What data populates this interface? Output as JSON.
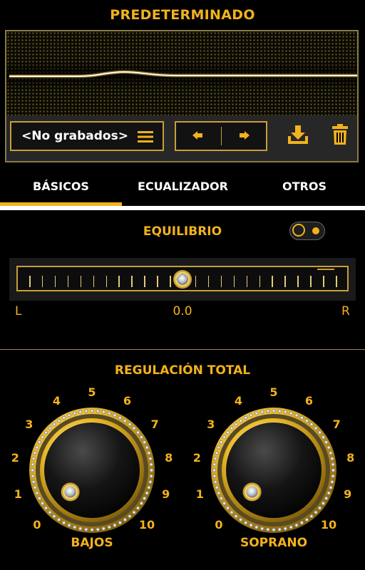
{
  "header": {
    "title": "PREDETERMINADO"
  },
  "presets": {
    "selected_label": "<No grabados>",
    "menu_icon": "list-icon",
    "prev_icon": "arrow-left-icon",
    "next_icon": "arrow-right-icon",
    "save_icon": "download-icon",
    "delete_icon": "trash-icon"
  },
  "tabs": [
    {
      "label": "BÁSICOS",
      "active": true
    },
    {
      "label": "ECUALIZADOR",
      "active": false
    },
    {
      "label": "OTROS",
      "active": false
    }
  ],
  "balance": {
    "title": "EQUILIBRIO",
    "toggle_on": true,
    "left_label": "L",
    "right_label": "R",
    "value_text": "0.0",
    "value": 0.0
  },
  "total_control": {
    "title": "REGULACIÓN TOTAL",
    "scale_labels": [
      "0",
      "1",
      "2",
      "3",
      "4",
      "5",
      "6",
      "7",
      "8",
      "9",
      "10"
    ],
    "knobs": [
      {
        "label": "BAJOS",
        "value": 0
      },
      {
        "label": "SOPRANO",
        "value": 0
      }
    ]
  },
  "colors": {
    "accent": "#f2b21c",
    "frame": "#c99e3a",
    "background": "#000000"
  }
}
